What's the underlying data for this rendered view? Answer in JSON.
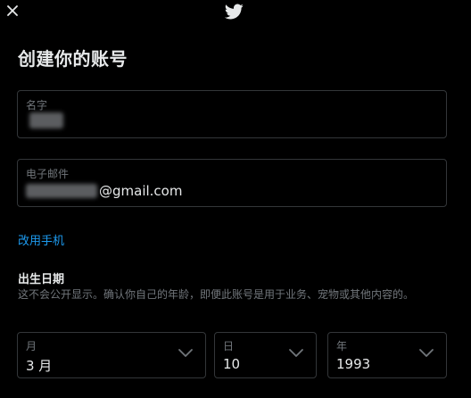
{
  "header": {
    "close_icon": "close-icon",
    "logo_icon": "twitter-bird-icon",
    "colors": {
      "background": "#000000",
      "logo": "#e7e9ea",
      "accent": "#1d9bf0"
    }
  },
  "form": {
    "title": "创建你的账号",
    "name_field": {
      "label": "名字"
    },
    "email_field": {
      "label": "电子邮件",
      "value": "@gmail.com"
    },
    "switch_to_phone": "改用手机",
    "dob": {
      "title": "出生日期",
      "description": "这不会公开显示。确认你自己的年龄，即便此账号是用于业务、宠物或其他内容的。",
      "month": {
        "label": "月",
        "value": "3 月"
      },
      "day": {
        "label": "日",
        "value": "10"
      },
      "year": {
        "label": "年",
        "value": "1993"
      }
    }
  }
}
